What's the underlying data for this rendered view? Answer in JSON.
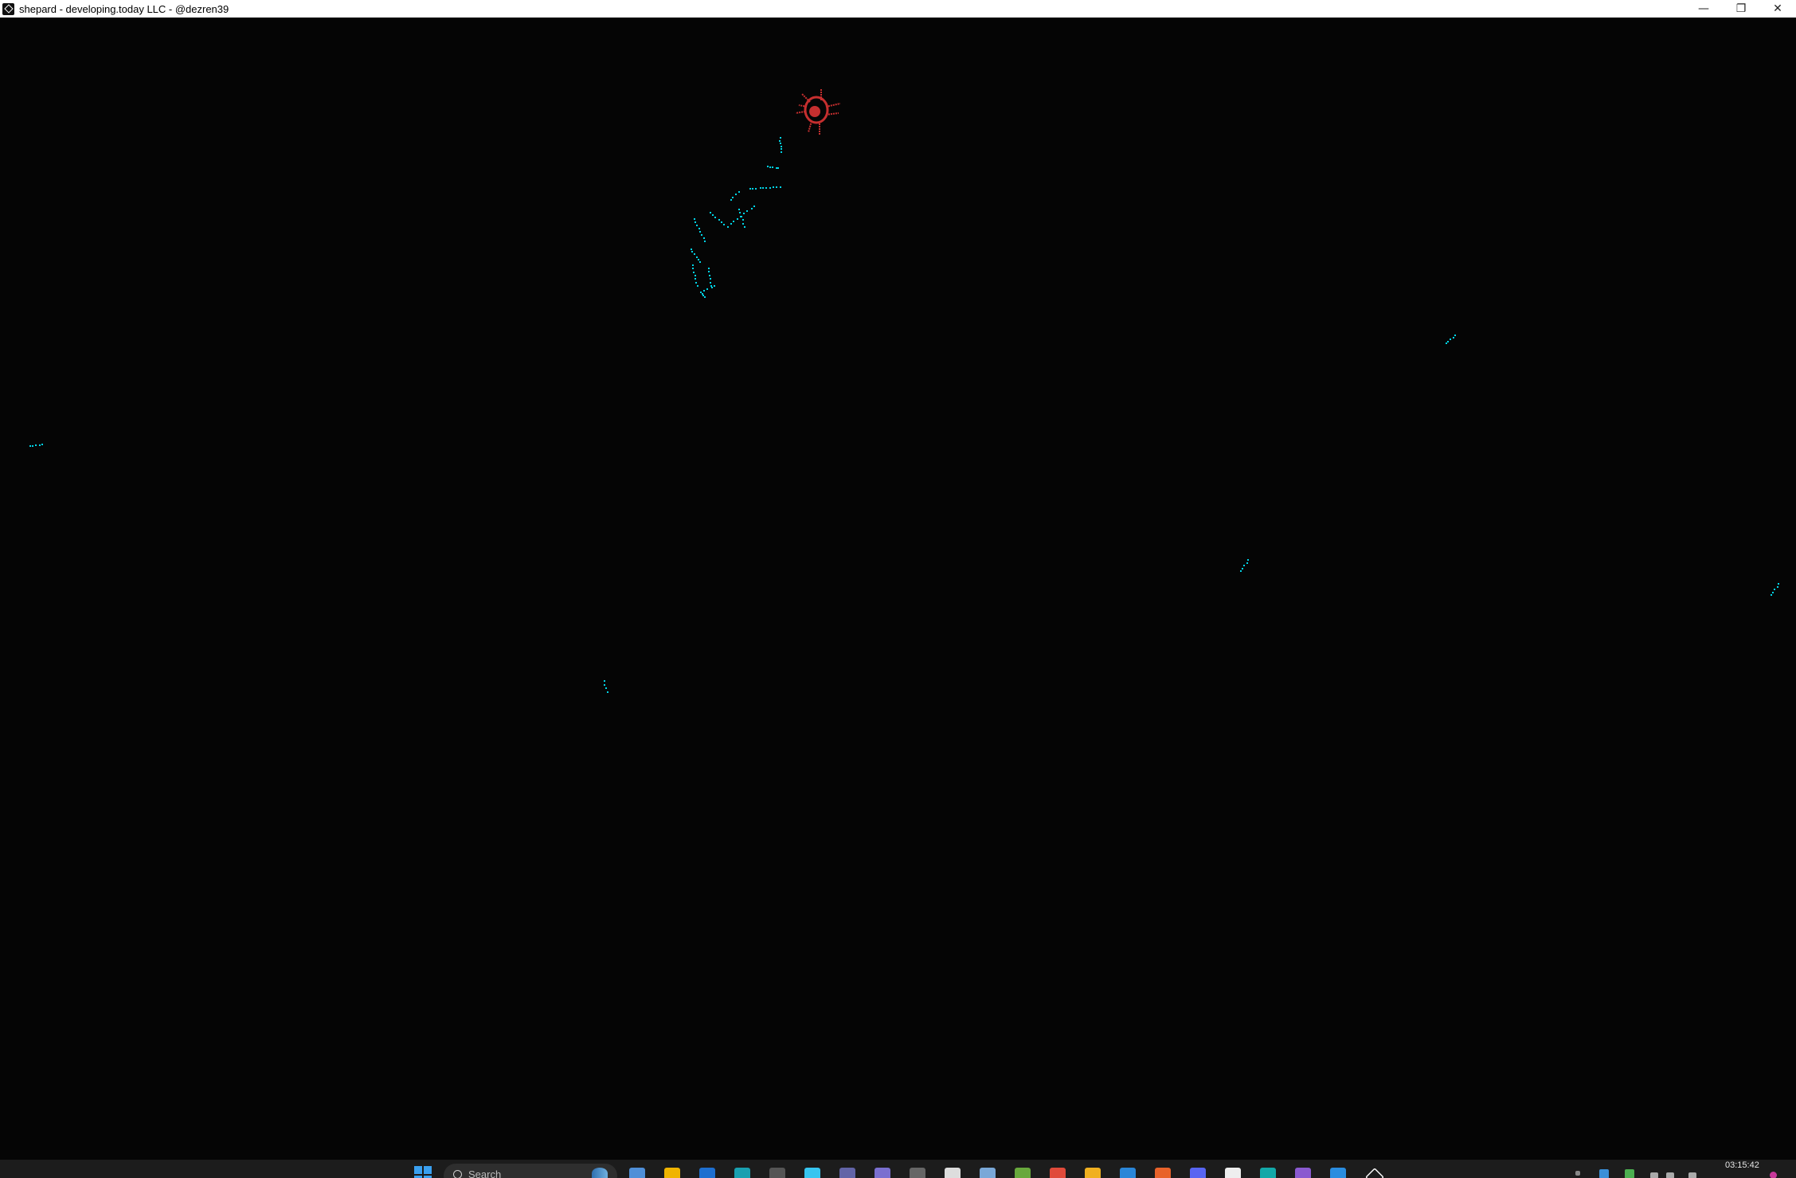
{
  "window": {
    "title": "shepard - developing.today LLC - @dezren39",
    "controls": {
      "minimize": "—",
      "maximize": "❐",
      "close": "✕"
    }
  },
  "scene": {
    "background_color": "#050505",
    "trail_color": "#00d4e6",
    "creature_color": "#c62f2f"
  },
  "taskbar": {
    "search_placeholder": "Search",
    "clock_time": "03:15:42",
    "apps": [
      {
        "name": "copilot-icon",
        "color": "#4f8fd8"
      },
      {
        "name": "file-explorer-icon",
        "color": "#f0b400"
      },
      {
        "name": "mail-icon",
        "color": "#1e6fd0"
      },
      {
        "name": "edge-icon",
        "color": "#19a0b0"
      },
      {
        "name": "terminal-icon",
        "color": "#555555"
      },
      {
        "name": "slack-icon",
        "color": "#36c5f0"
      },
      {
        "name": "app-purple-icon",
        "color": "#6264a7"
      },
      {
        "name": "app-circle-icon",
        "color": "#7a6fd0"
      },
      {
        "name": "github-icon",
        "color": "#666666"
      },
      {
        "name": "notepad-icon",
        "color": "#dddddd"
      },
      {
        "name": "tools-icon",
        "color": "#7aa8d8"
      },
      {
        "name": "play-icon",
        "color": "#68a83c"
      },
      {
        "name": "chrome-icon",
        "color": "#e04a3a"
      },
      {
        "name": "chrome-canary-icon",
        "color": "#f0b020"
      },
      {
        "name": "store-icon",
        "color": "#2a86d8"
      },
      {
        "name": "firefox-icon",
        "color": "#e8622a"
      },
      {
        "name": "discord-icon",
        "color": "#5865f2"
      },
      {
        "name": "twitch-icon",
        "color": "#eeeeee"
      },
      {
        "name": "shepard-app-icon",
        "color": "#13a8a8"
      },
      {
        "name": "visual-studio-icon",
        "color": "#8a5ad0"
      },
      {
        "name": "vscode-icon",
        "color": "#2a8de0"
      },
      {
        "name": "shepard-active-icon",
        "color": "#ffffff"
      }
    ]
  }
}
